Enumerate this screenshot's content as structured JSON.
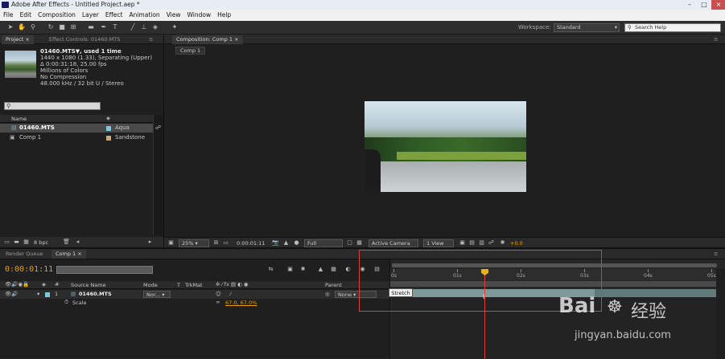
{
  "window": {
    "title": "Adobe After Effects - Untitled Project.aep *"
  },
  "menu": [
    "File",
    "Edit",
    "Composition",
    "Layer",
    "Effect",
    "Animation",
    "View",
    "Window",
    "Help"
  ],
  "toolbar": {
    "workspace_label": "Workspace:",
    "workspace_value": "Standard",
    "search_placeholder": "Search Help"
  },
  "project": {
    "tab_project": "Project",
    "tab_effect": "Effect Controls: 01460.MTS",
    "footage_name": "01460.MTS▼, used 1 time",
    "info": [
      "1440 x 1080 (1.33), Separating (Upper)",
      "Δ 0:00:31:18, 25.00 fps",
      "Millions of Colors",
      "No Compression",
      "48.000 kHz / 32 bit U / Stereo"
    ],
    "col_name": "Name",
    "col_tr": "Tr",
    "items": [
      {
        "name": "01460.MTS",
        "label": "Aqua",
        "color": "#7fc8d8"
      },
      {
        "name": "Comp 1",
        "label": "Sandstone",
        "color": "#c8a878"
      }
    ],
    "bpc": "8 bpc"
  },
  "composition": {
    "tab": "Composition: Comp 1",
    "subtab": "Comp 1",
    "zoom": "25%",
    "timecode": "0:00:01:11",
    "resolution": "Full",
    "camera": "Active Camera",
    "view": "1 View",
    "exposure": "+0.0"
  },
  "timeline": {
    "tab_render": "Render Queue",
    "tab_comp": "Comp 1",
    "timecode": "0:00:01:11",
    "headers": {
      "source": "Source Name",
      "mode": "Mode",
      "t": "T",
      "trkmat": "TrkMat",
      "parent": "Parent"
    },
    "layer": {
      "index": "1",
      "name": "01460.MTS",
      "mode": "Nor...",
      "parent": "None"
    },
    "property": {
      "name": "Scale",
      "value": "67.0, 67.0%"
    },
    "ruler": [
      "0s",
      "01s",
      "02s",
      "03s",
      "04s",
      "05s"
    ],
    "tooltip": "Stretch"
  },
  "watermark": {
    "brand": "Bai",
    "brand2": "经验",
    "url": "jingyan.baidu.com"
  }
}
